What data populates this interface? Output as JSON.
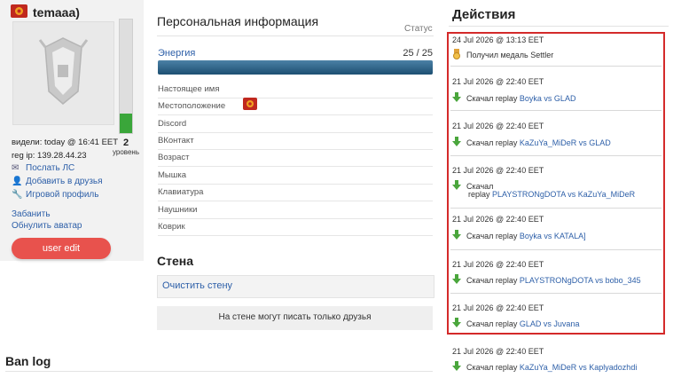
{
  "profile": {
    "username": "temaaa)",
    "level_value": "2",
    "level_word": "уровень",
    "level_progress": 0.18,
    "seen": "видели: today @ 16:41 EET",
    "reg_ip": "reg ip: 139.28.44.23",
    "links": [
      {
        "label": "Послать ЛС",
        "icon": "mail-icon"
      },
      {
        "label": "Добавить в друзья",
        "icon": "add-friend-icon"
      },
      {
        "label": "Игровой профиль",
        "icon": "game-profile-icon"
      }
    ],
    "ban_label": "Забанить",
    "reset_avatar_label": "Обнулить аватар",
    "user_edit_label": "user edit"
  },
  "info": {
    "title": "Персональная информация",
    "status_label": "Статус",
    "energy_label": "Энергия",
    "energy_value": "25 / 25",
    "energy_fraction": 1.0,
    "rows": [
      "Настоящее имя",
      "Местоположение",
      "Discord",
      "ВКонтакт",
      "Возраст",
      "Мышка",
      "Клавиатура",
      "Наушники",
      "Коврик"
    ]
  },
  "wall": {
    "title": "Стена",
    "clear_label": "Очистить стену",
    "note": "На стене могут писать только друзья"
  },
  "ban_log": {
    "title": "Ban log"
  },
  "actions": {
    "title": "Действия",
    "items": [
      {
        "date": "24 Jul 2026 @ 13:13 EET",
        "icon": "medal-icon",
        "verb": "Получил медаль",
        "target": "Settler"
      },
      {
        "date": "21 Jul 2026 @ 22:40 EET",
        "icon": "download-icon",
        "verb": "Скачал  replay",
        "target": "Boyka vs GLAD"
      },
      {
        "date": "21 Jul 2026 @ 22:40 EET",
        "icon": "download-icon",
        "verb": "Скачал  replay",
        "target": "KaZuYa_MiDeR vs GLAD"
      },
      {
        "date": "21 Jul 2026 @ 22:40 EET",
        "icon": "download-icon",
        "verb": "Скачал",
        "verb2": "replay",
        "target": "PLAYSTRONgDOTA vs KaZuYa_MiDeR"
      },
      {
        "date": "21 Jul 2026 @ 22:40 EET",
        "icon": "download-icon",
        "verb": "Скачал  replay",
        "target": "Boyka vs KATALA]"
      },
      {
        "date": "21 Jul 2026 @ 22:40 EET",
        "icon": "download-icon",
        "verb": "Скачал  replay",
        "target": "PLAYSTRONgDOTA vs bobo_345"
      },
      {
        "date": "21 Jul 2026 @ 22:40 EET",
        "icon": "download-icon",
        "verb": "Скачал  replay",
        "target": "GLAD vs Juvana"
      },
      {
        "date": "21 Jul 2026 @ 22:40 EET",
        "icon": "download-icon",
        "verb": "Скачал  replay",
        "target": "KaZuYa_MiDeR vs Kaplyadozhdi"
      }
    ]
  }
}
